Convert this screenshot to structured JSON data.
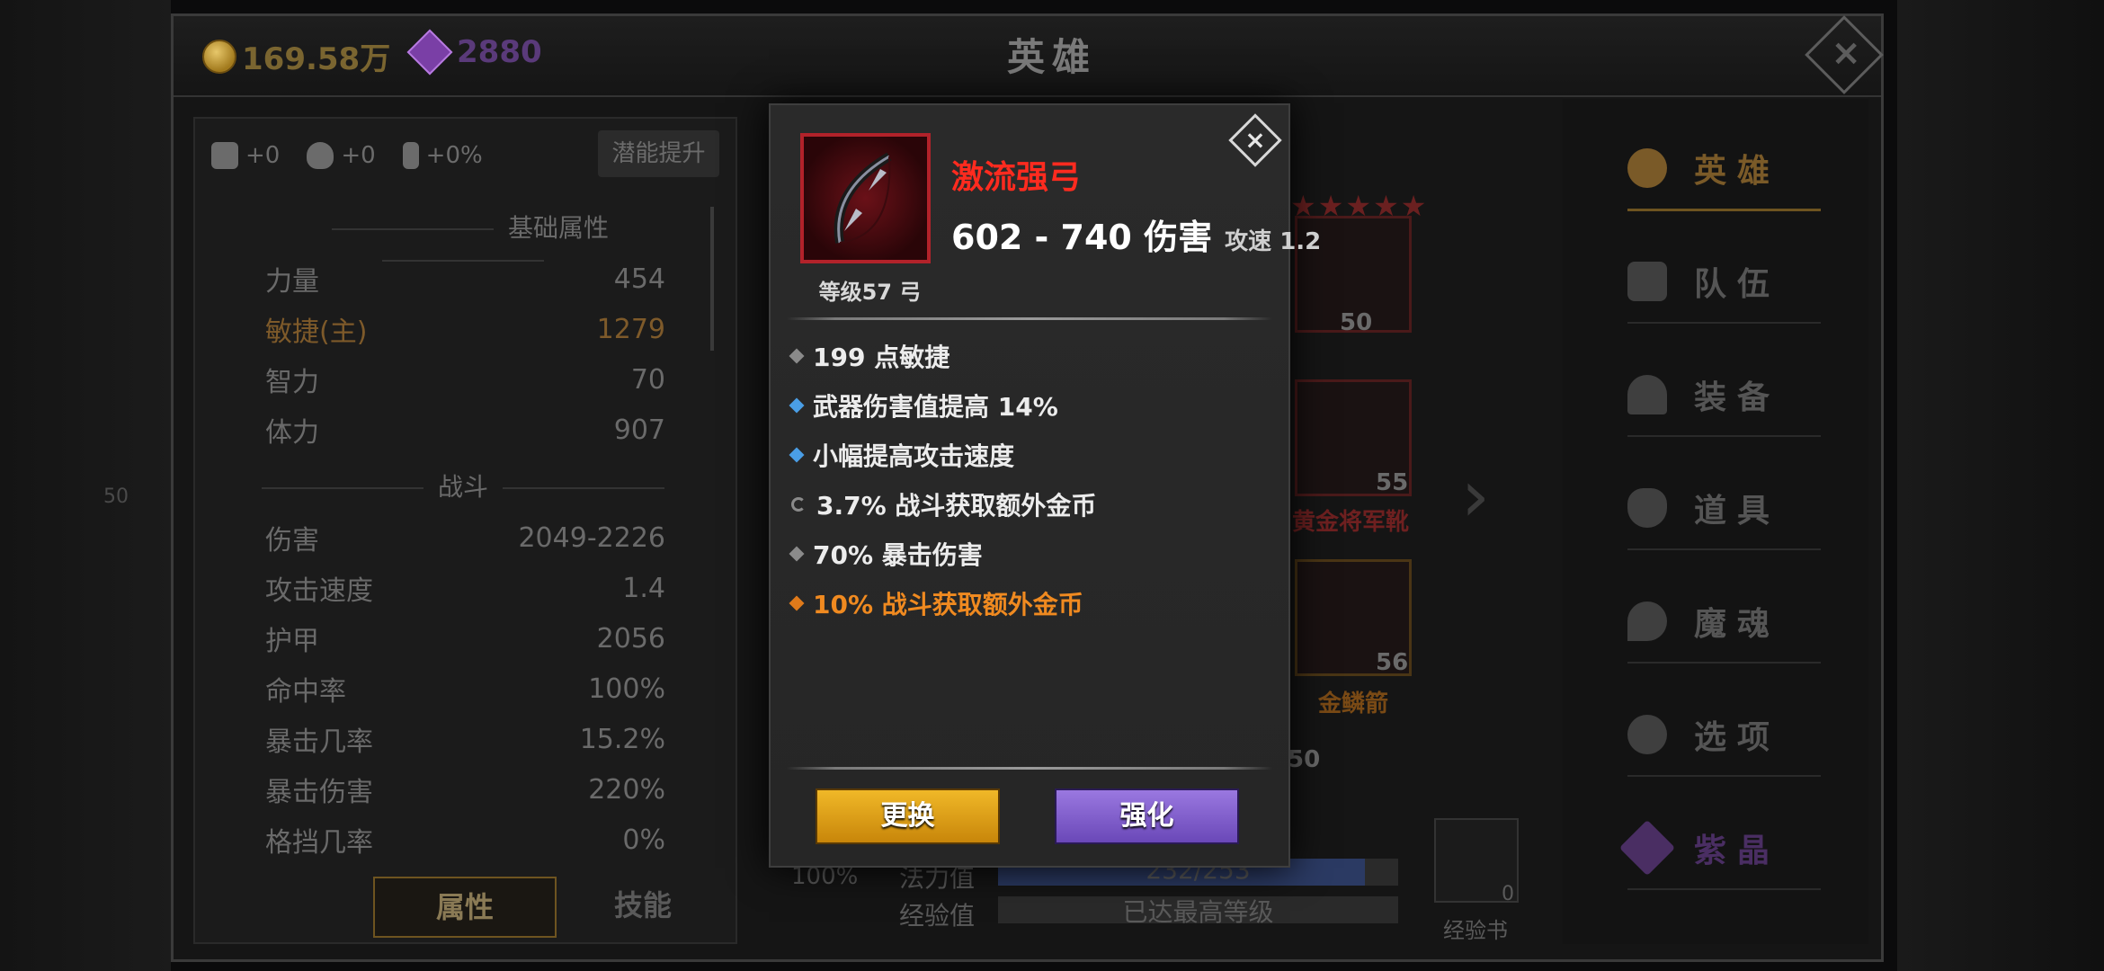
{
  "header": {
    "gold": "169.58万",
    "gems": "2880",
    "title": "英雄",
    "close_icon": "close-icon"
  },
  "left_panel": {
    "potentials": [
      {
        "icon": "strength-arm-icon",
        "value": "+0"
      },
      {
        "icon": "heart-icon",
        "value": "+0"
      },
      {
        "icon": "lightning-icon",
        "value": "+0%"
      }
    ],
    "potential_button": "潜能提升",
    "basic_header": "基础属性",
    "basic_stats": [
      {
        "label": "力量",
        "value": "454"
      },
      {
        "label": "敏捷(主)",
        "value": "1279"
      },
      {
        "label": "智力",
        "value": "70"
      },
      {
        "label": "体力",
        "value": "907"
      }
    ],
    "combat_header": "战斗",
    "combat_stats": [
      {
        "label": "伤害",
        "value": "2049-2226"
      },
      {
        "label": "攻击速度",
        "value": "1.4"
      },
      {
        "label": "护甲",
        "value": "2056"
      },
      {
        "label": "命中率",
        "value": "100%"
      },
      {
        "label": "暴击几率",
        "value": "15.2%"
      },
      {
        "label": "暴击伤害",
        "value": "220%"
      },
      {
        "label": "格挡几率",
        "value": "0%"
      }
    ],
    "tabs": [
      "属性",
      "技能"
    ]
  },
  "middle": {
    "slot_levels": [
      "50",
      "55",
      "56"
    ],
    "slot_names": [
      "黄金将军靴",
      "金鳞箭"
    ],
    "left_scene_level": "50",
    "partial_num": "50",
    "mana_label": "法力值",
    "mana_value": "232/253",
    "mana_fraction": 0.917,
    "exp_label": "经验值",
    "exp_value": "已达最高等级",
    "potion_percent": "100%",
    "expbook_label": "经验书",
    "expbook_count": "0"
  },
  "right_nav": [
    {
      "label": "英雄",
      "icon": "heroes-icon"
    },
    {
      "label": "队伍",
      "icon": "flag-icon"
    },
    {
      "label": "装备",
      "icon": "helmet-icon"
    },
    {
      "label": "道具",
      "icon": "bag-icon"
    },
    {
      "label": "魔魂",
      "icon": "flame-icon"
    },
    {
      "label": "选项",
      "icon": "gear-icon"
    },
    {
      "label": "紫晶",
      "icon": "crystal-icon"
    }
  ],
  "popup": {
    "item_name": "激流强弓",
    "damage": "602 - 740 伤害",
    "speed_label": "攻速",
    "speed_value": "1.2",
    "level_text": "等级57 弓",
    "attributes": [
      {
        "text": "199 点敏捷",
        "marker": "gray-diamond"
      },
      {
        "text": "武器伤害值提高 14%",
        "marker": "blue-diamond"
      },
      {
        "text": "小幅提高攻击速度",
        "marker": "blue-diamond"
      },
      {
        "text": "3.7% 战斗获取额外金币",
        "marker": "cycle"
      },
      {
        "text": "70% 暴击伤害",
        "marker": "gray-diamond"
      },
      {
        "text": "10% 战斗获取额外金币",
        "marker": "orange-diamond"
      }
    ],
    "swap_button": "更换",
    "forge_button": "强化"
  }
}
